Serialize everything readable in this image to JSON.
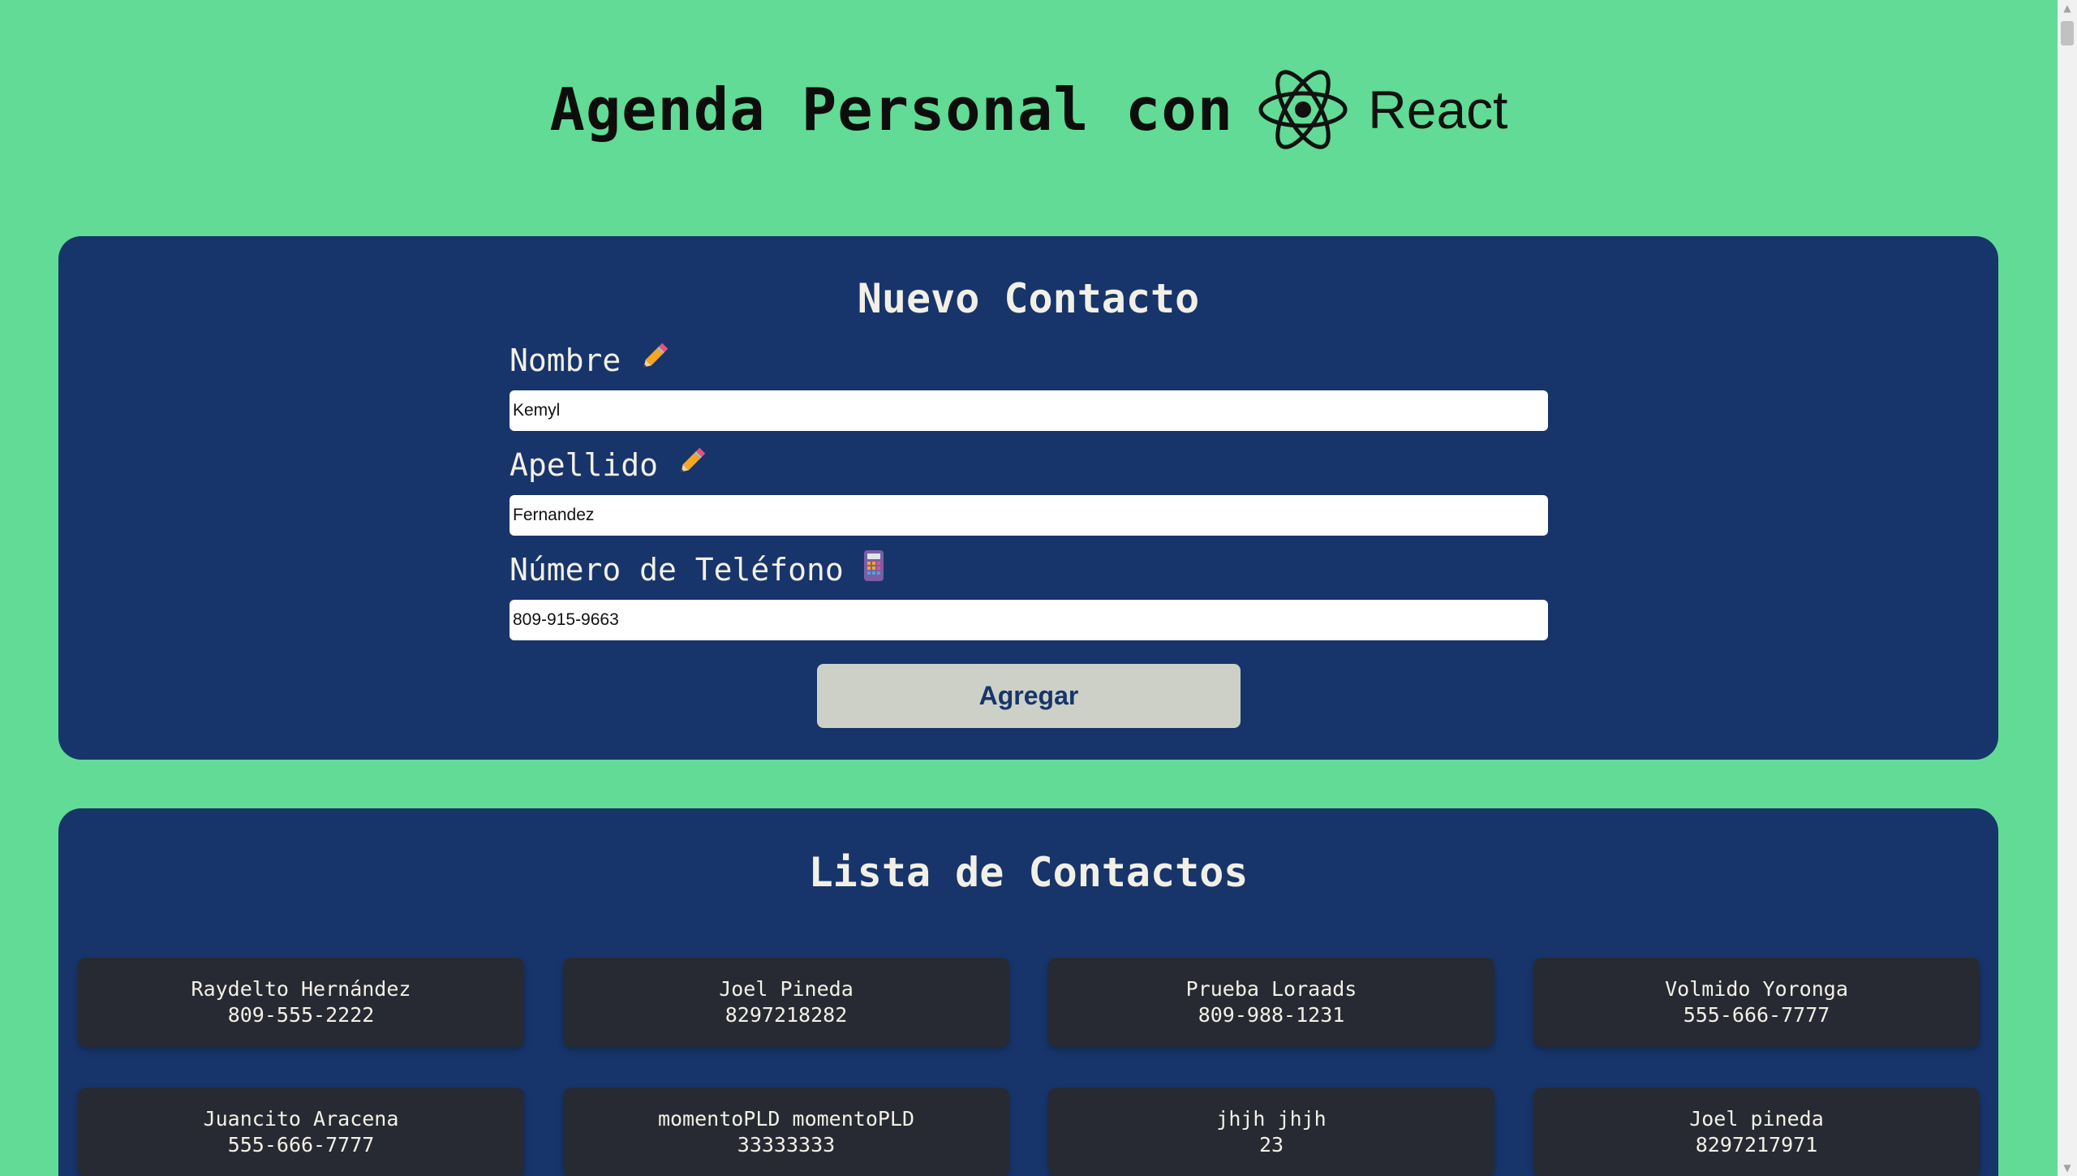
{
  "header": {
    "title": "Agenda Personal con",
    "react_word": "React",
    "logo_icon": "react-atom-icon"
  },
  "form": {
    "title": "Nuevo Contacto",
    "nombre": {
      "label": "Nombre",
      "icon": "pencil-icon",
      "value": "Kemyl"
    },
    "apellido": {
      "label": "Apellido",
      "icon": "pencil-icon",
      "value": "Fernandez"
    },
    "telefono": {
      "label": "Número de Teléfono",
      "icon": "calculator-icon",
      "value": "809-915-9663"
    },
    "submit_label": "Agregar"
  },
  "list": {
    "title": "Lista de Contactos",
    "contacts": [
      {
        "name": "Raydelto Hernández",
        "phone": "809-555-2222"
      },
      {
        "name": "Joel Pineda",
        "phone": "8297218282"
      },
      {
        "name": "Prueba Loraads",
        "phone": "809-988-1231"
      },
      {
        "name": "Volmido Yoronga",
        "phone": "555-666-7777"
      },
      {
        "name": "Juancito Aracena",
        "phone": "555-666-7777"
      },
      {
        "name": "momentoPLD momentoPLD",
        "phone": "33333333"
      },
      {
        "name": "jhjh jhjh",
        "phone": "23"
      },
      {
        "name": "Joel pineda",
        "phone": "8297217971"
      }
    ]
  },
  "colors": {
    "background": "#61db95",
    "panel": "#17356b",
    "card": "#272a32",
    "button": "#ccd0c6",
    "text_light": "#f2f0e6"
  }
}
